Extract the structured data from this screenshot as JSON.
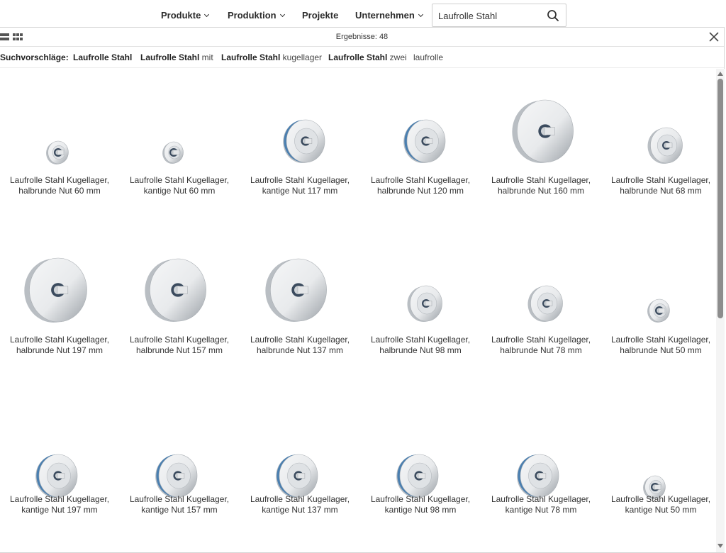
{
  "nav": {
    "items": [
      {
        "label": "Produkte",
        "dropdown": true
      },
      {
        "label": "Produktion",
        "dropdown": true
      },
      {
        "label": "Projekte",
        "dropdown": false
      },
      {
        "label": "Unternehmen",
        "dropdown": true
      }
    ],
    "search": {
      "value": "Laufrolle Stahl",
      "icon": "search-icon"
    }
  },
  "results": {
    "count_label": "Ergebnisse: 48",
    "view_icons": [
      "list-view-icon",
      "grid-view-icon"
    ],
    "close_icon": "close-icon"
  },
  "suggestions": {
    "label": "Suchvorschläge:",
    "items": [
      {
        "bold": "Laufrolle Stahl",
        "rest": ""
      },
      {
        "bold": "Laufrolle Stahl",
        "rest": " mit"
      },
      {
        "bold": "Laufrolle Stahl",
        "rest": " kugellager"
      },
      {
        "bold": "Laufrolle Stahl",
        "rest": " zwei"
      },
      {
        "bold": "",
        "rest": "laufrolle"
      }
    ]
  },
  "products": [
    {
      "line1": "Laufrolle Stahl Kugellager,",
      "line2": "halbrunde Nut 60 mm",
      "style": "round"
    },
    {
      "line1": "Laufrolle Stahl Kugellager,",
      "line2": "kantige Nut 60 mm",
      "style": "round"
    },
    {
      "line1": "Laufrolle Stahl Kugellager,",
      "line2": "kantige Nut 117 mm",
      "style": "v-groove"
    },
    {
      "line1": "Laufrolle Stahl Kugellager,",
      "line2": "halbrunde Nut 120 mm",
      "style": "v-groove"
    },
    {
      "line1": "Laufrolle Stahl Kugellager,",
      "line2": "halbrunde Nut 160 mm",
      "style": "large"
    },
    {
      "line1": "Laufrolle Stahl Kugellager,",
      "line2": "halbrunde Nut 68 mm",
      "style": "round"
    },
    {
      "line1": "Laufrolle Stahl Kugellager,",
      "line2": "halbrunde Nut 197 mm",
      "style": "large"
    },
    {
      "line1": "Laufrolle Stahl Kugellager,",
      "line2": "halbrunde Nut 157 mm",
      "style": "large"
    },
    {
      "line1": "Laufrolle Stahl Kugellager,",
      "line2": "halbrunde Nut 137 mm",
      "style": "large"
    },
    {
      "line1": "Laufrolle Stahl Kugellager,",
      "line2": "halbrunde Nut 98 mm",
      "style": "round"
    },
    {
      "line1": "Laufrolle Stahl Kugellager,",
      "line2": "halbrunde Nut 78 mm",
      "style": "round"
    },
    {
      "line1": "Laufrolle Stahl Kugellager,",
      "line2": "halbrunde Nut 50 mm",
      "style": "round"
    },
    {
      "line1": "Laufrolle Stahl Kugellager,",
      "line2": "kantige Nut 197 mm",
      "style": "v-groove"
    },
    {
      "line1": "Laufrolle Stahl Kugellager,",
      "line2": "kantige Nut 157 mm",
      "style": "v-groove"
    },
    {
      "line1": "Laufrolle Stahl Kugellager,",
      "line2": "kantige Nut 137 mm",
      "style": "v-groove"
    },
    {
      "line1": "Laufrolle Stahl Kugellager,",
      "line2": "kantige Nut 98 mm",
      "style": "v-groove"
    },
    {
      "line1": "Laufrolle Stahl Kugellager,",
      "line2": "kantige Nut 78 mm",
      "style": "v-groove"
    },
    {
      "line1": "Laufrolle Stahl Kugellager,",
      "line2": "kantige Nut 50 mm",
      "style": "round"
    }
  ],
  "colors": {
    "text": "#333333",
    "steel_light": "#e8eaec",
    "steel_dark": "#9aa0a6",
    "groove_blue": "#4a7fb0",
    "scroll_thumb": "#8d8d8d"
  }
}
